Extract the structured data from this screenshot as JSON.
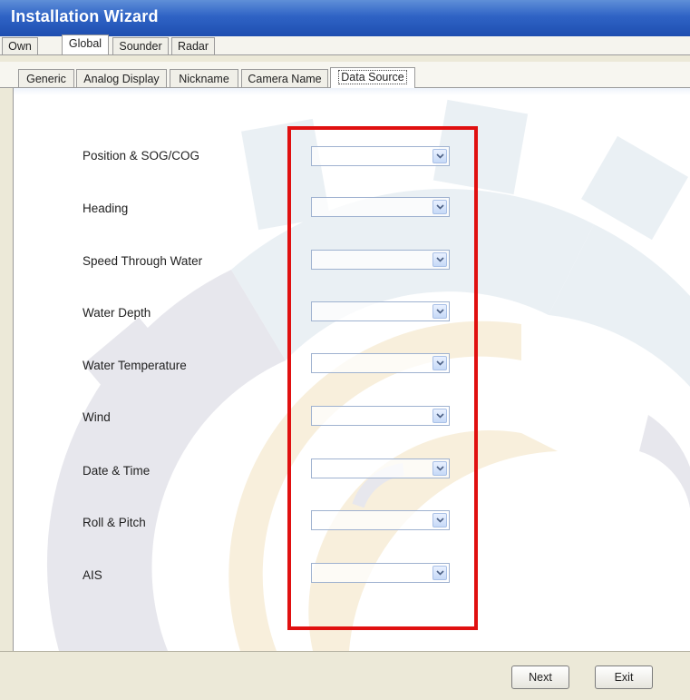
{
  "window": {
    "title": "Installation Wizard"
  },
  "tabs_top": [
    {
      "label": "Own",
      "active": false
    },
    {
      "label": "Global",
      "active": true
    },
    {
      "label": "Sounder",
      "active": false
    },
    {
      "label": "Radar",
      "active": false
    }
  ],
  "tabs_sub": [
    {
      "label": "Generic",
      "active": false
    },
    {
      "label": "Analog Display",
      "active": false
    },
    {
      "label": "Nickname",
      "active": false
    },
    {
      "label": "Camera Name",
      "active": false
    },
    {
      "label": "Data Source",
      "active": true
    }
  ],
  "data_sources": [
    {
      "label": "Position & SOG/COG",
      "value": ""
    },
    {
      "label": "Heading",
      "value": ""
    },
    {
      "label": "Speed Through Water",
      "value": ""
    },
    {
      "label": "Water Depth",
      "value": ""
    },
    {
      "label": "Water Temperature",
      "value": ""
    },
    {
      "label": "Wind",
      "value": ""
    },
    {
      "label": "Date & Time",
      "value": ""
    },
    {
      "label": "Roll & Pitch",
      "value": ""
    },
    {
      "label": "AIS",
      "value": ""
    }
  ],
  "buttons": {
    "next": "Next",
    "exit": "Exit"
  },
  "colors": {
    "highlight": "#e01010",
    "title_bar": "#2f63c5"
  }
}
